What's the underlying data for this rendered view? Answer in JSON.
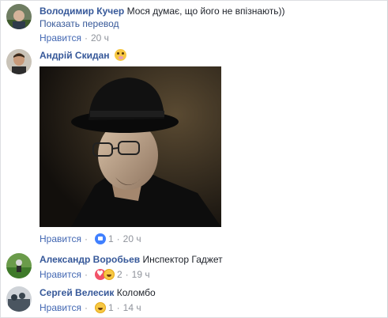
{
  "comments": [
    {
      "author": "Володимир Кучер",
      "text": "Мося думає, що його не впізнають))",
      "translate": "Показать перевод",
      "like": "Нравится",
      "time": "20 ч"
    },
    {
      "author": "Андрій Скидан",
      "like": "Нравится",
      "reaction_count": "1",
      "time": "20 ч"
    },
    {
      "author": "Александр Воробьев",
      "text": "Инспектор Гаджет",
      "like": "Нравится",
      "reaction_count": "2",
      "time": "19 ч"
    },
    {
      "author": "Сергей Велесик",
      "text": "Коломбо",
      "like": "Нравится",
      "reaction_count": "1",
      "time": "14 ч"
    }
  ],
  "colors": {
    "link": "#365899",
    "like": "#4267b2",
    "meta": "#90949c"
  }
}
